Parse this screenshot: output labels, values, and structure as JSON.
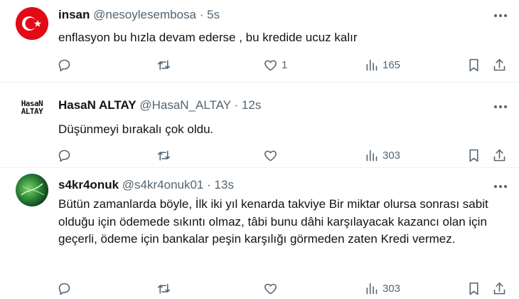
{
  "tweets": [
    {
      "name": "insan",
      "handle": "@nesoylesembosa",
      "separator": "·",
      "time": "5s",
      "text": "enflasyon bu hızla devam ederse , bu kredide ucuz kalır",
      "replies": "",
      "retweets": "",
      "likes": "1",
      "views": "165",
      "avatar": "turkish-flag"
    },
    {
      "name": "HasaN ALTAY",
      "handle": "@HasaN_ALTAY",
      "separator": "·",
      "time": "12s",
      "text": "Düşünmeyi bırakalı çok oldu.",
      "replies": "",
      "retweets": "",
      "likes": "",
      "views": "303",
      "avatar_text_line1": "HasaN",
      "avatar_text_line2": "ALTAY"
    },
    {
      "name": "s4kr4onuk",
      "handle": "@s4kr4onuk01",
      "separator": "·",
      "time": "13s",
      "text": "Bütün zamanlarda böyle, İlk iki yıl kenarda takviye Bir miktar olursa sonrası sabit olduğu için ödemede sıkıntı olmaz, tâbi bunu dâhi karşılayacak kazancı olan için geçerli, ödeme için bankalar peşin karşılığı görmeden zaten Kredi vermez.",
      "replies": "",
      "retweets": "",
      "likes": "",
      "views": "303",
      "avatar": "green-abstract"
    }
  ],
  "colors": {
    "text": "#0f1419",
    "secondary": "#536471",
    "divider": "#eff3f4",
    "flag_red": "#e30a17"
  },
  "icons": [
    "reply-icon",
    "retweet-icon",
    "like-icon",
    "views-icon",
    "bookmark-icon",
    "share-icon",
    "more-icon"
  ]
}
